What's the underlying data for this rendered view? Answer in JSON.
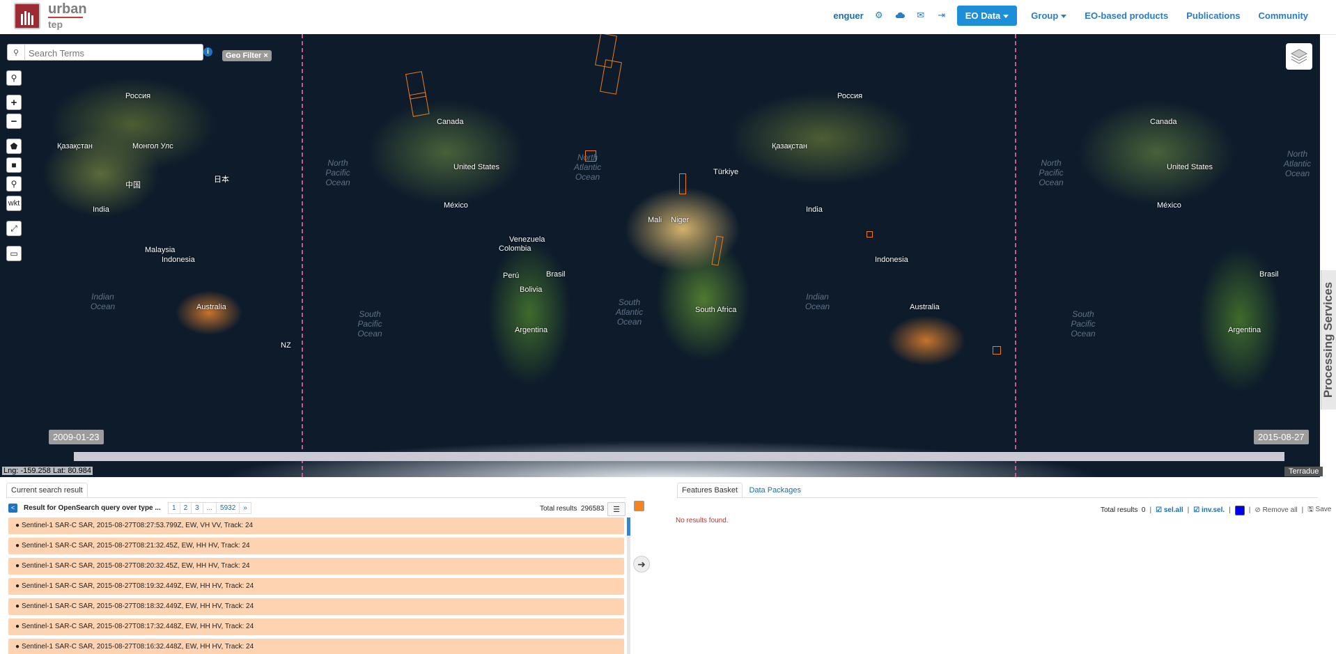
{
  "header": {
    "logo_top": "urban",
    "logo_bottom": "tep",
    "user": "enguer",
    "icons": [
      "gear-icon",
      "cloud-icon",
      "envelope-icon",
      "logout-icon"
    ],
    "eo_data": "EO Data",
    "group": "Group",
    "nav_links": [
      "EO-based products",
      "Publications",
      "Community"
    ]
  },
  "search": {
    "placeholder": "Search Terms"
  },
  "geo_filter": "Geo Filter ×",
  "map_tools": [
    "search-icon",
    "zoom-in",
    "zoom-out",
    "polygon-tool",
    "rectangle-tool",
    "point-tool",
    "wkt",
    "fullscreen-icon",
    "ruler-icon"
  ],
  "map_labels": {
    "russia_l": "Россия",
    "canada_l": "Canada",
    "kazakhstan_l": "Қазақстан",
    "mongolia_l": "Монгол Улс",
    "china_l": "中国",
    "japan_l": "日本",
    "india_l": "India",
    "indonesia_l": "Indonesia",
    "australia_l": "Australia",
    "malaysia_l": "Malaysia",
    "us_l": "United States",
    "mexico_l": "México",
    "venezuela_l": "Venezuela",
    "colombia_l": "Colombia",
    "peru_l": "Perú",
    "brasil_l": "Brasil",
    "bolivia_l": "Bolivia",
    "argentina_l": "Argentina",
    "nz_l": "NZ",
    "mali_l": "Mali",
    "niger_l": "Niger",
    "sa_l": "South Africa",
    "turkey_l": "Türkiye",
    "russia_r": "Россия",
    "canada_r": "Canada",
    "kazakhstan_r": "Қазақстан",
    "india_r": "India",
    "indonesia_r": "Indonesia",
    "australia_r": "Australia",
    "us_r": "United States",
    "mexico_r": "México",
    "brasil_r": "Brasil",
    "argentina_r": "Argentina"
  },
  "oceans": {
    "np": "North Pacific Ocean",
    "sp": "South Pacific Ocean",
    "na": "North Atlantic Ocean",
    "sa": "South Atlantic Ocean",
    "io_l": "Indian Ocean",
    "io_r": "Indian Ocean",
    "sp_r": "South Pacific Ocean",
    "na_r": "North Atlantic Ocean"
  },
  "timeline": {
    "start": "2009-01-23",
    "end": "2015-08-27"
  },
  "coordinates": "Lng: -159.258 Lat: 80.984",
  "attribution": "Terradue",
  "processing_services": "Processing Services",
  "left_panel": {
    "tab": "Current search result",
    "title": "Result for OpenSearch query over type ...",
    "pages": [
      "1",
      "2",
      "3",
      "...",
      "5932",
      "»"
    ],
    "total_label": "Total results",
    "total_value": "296583",
    "rows": [
      "Sentinel-1 SAR-C SAR, 2015-08-27T08:27:53.799Z, EW, VH VV, Track: 24",
      "Sentinel-1 SAR-C SAR, 2015-08-27T08:21:32.45Z, EW, HH HV, Track: 24",
      "Sentinel-1 SAR-C SAR, 2015-08-27T08:20:32.45Z, EW, HH HV, Track: 24",
      "Sentinel-1 SAR-C SAR, 2015-08-27T08:19:32.449Z, EW, HH HV, Track: 24",
      "Sentinel-1 SAR-C SAR, 2015-08-27T08:18:32.449Z, EW, HH HV, Track: 24",
      "Sentinel-1 SAR-C SAR, 2015-08-27T08:17:32.448Z, EW, HH HV, Track: 24",
      "Sentinel-1 SAR-C SAR, 2015-08-27T08:16:32.448Z, EW, HH HV, Track: 24"
    ]
  },
  "right_panel": {
    "tabs": [
      "Features Basket",
      "Data Packages"
    ],
    "total_label": "Total results",
    "total_value": "0",
    "sel_all": "sel.all",
    "inv_sel": "inv.sel.",
    "remove_all": "Remove all",
    "save": "Save",
    "no_results": "No results found."
  },
  "colors": {
    "accent": "#1d8fd8",
    "result_row": "#fdd3b1",
    "footprint": "#f17d1a",
    "brand": "#9c2b33"
  }
}
